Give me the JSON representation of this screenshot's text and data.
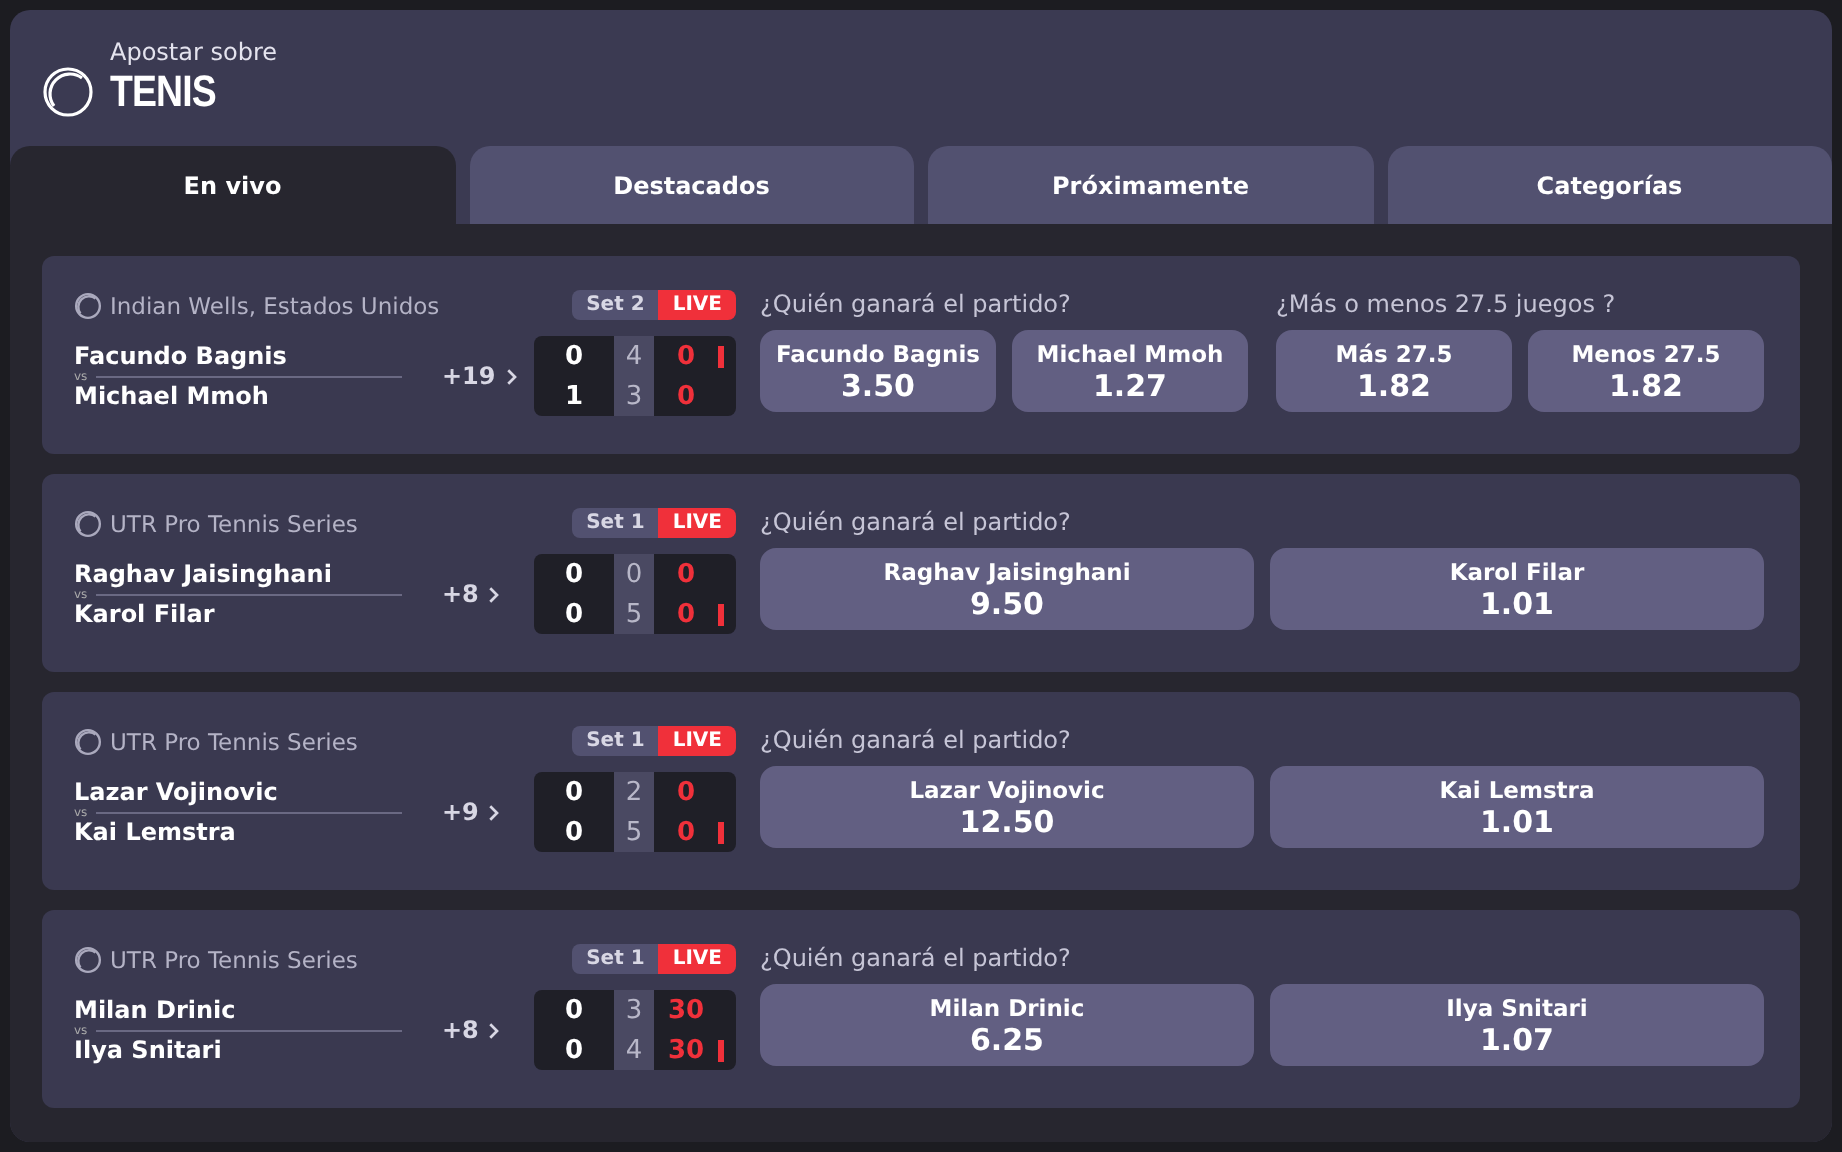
{
  "header": {
    "subtitle": "Apostar sobre",
    "title": "TENIS"
  },
  "tabs": [
    {
      "label": "En vivo",
      "selected": true
    },
    {
      "label": "Destacados",
      "selected": false
    },
    {
      "label": "Próximamente",
      "selected": false
    },
    {
      "label": "Categorías",
      "selected": false
    }
  ],
  "matches": [
    {
      "tournament": "Indian Wells, Estados Unidos",
      "set": "Set 2",
      "live": "LIVE",
      "vs": "vs",
      "more": "+19",
      "players": [
        {
          "name": "Facundo Bagnis",
          "sets": "0",
          "games": "4",
          "points": "0",
          "serving": true
        },
        {
          "name": "Michael Mmoh",
          "sets": "1",
          "games": "3",
          "points": "0",
          "serving": false
        }
      ],
      "markets": [
        {
          "question": "¿Quién ganará el partido?",
          "options": [
            {
              "label": "Facundo Bagnis",
              "odds": "3.50"
            },
            {
              "label": "Michael Mmoh",
              "odds": "1.27"
            }
          ]
        },
        {
          "question": "¿Más o menos 27.5 juegos ?",
          "options": [
            {
              "label": "Más 27.5",
              "odds": "1.82"
            },
            {
              "label": "Menos 27.5",
              "odds": "1.82"
            }
          ]
        }
      ]
    },
    {
      "tournament": "UTR Pro Tennis Series",
      "set": "Set 1",
      "live": "LIVE",
      "vs": "vs",
      "more": "+8",
      "players": [
        {
          "name": "Raghav Jaisinghani",
          "sets": "0",
          "games": "0",
          "points": "0",
          "serving": false
        },
        {
          "name": "Karol Filar",
          "sets": "0",
          "games": "5",
          "points": "0",
          "serving": true
        }
      ],
      "markets": [
        {
          "question": "¿Quién ganará el partido?",
          "options": [
            {
              "label": "Raghav Jaisinghani",
              "odds": "9.50"
            },
            {
              "label": "Karol Filar",
              "odds": "1.01"
            }
          ]
        }
      ]
    },
    {
      "tournament": "UTR Pro Tennis Series",
      "set": "Set 1",
      "live": "LIVE",
      "vs": "vs",
      "more": "+9",
      "players": [
        {
          "name": "Lazar Vojinovic",
          "sets": "0",
          "games": "2",
          "points": "0",
          "serving": false
        },
        {
          "name": "Kai Lemstra",
          "sets": "0",
          "games": "5",
          "points": "0",
          "serving": true
        }
      ],
      "markets": [
        {
          "question": "¿Quién ganará el partido?",
          "options": [
            {
              "label": "Lazar Vojinovic",
              "odds": "12.50"
            },
            {
              "label": "Kai Lemstra",
              "odds": "1.01"
            }
          ]
        }
      ]
    },
    {
      "tournament": "UTR Pro Tennis Series",
      "set": "Set 1",
      "live": "LIVE",
      "vs": "vs",
      "more": "+8",
      "players": [
        {
          "name": "Milan Drinic",
          "sets": "0",
          "games": "3",
          "points": "30",
          "serving": false
        },
        {
          "name": "Ilya Snitari",
          "sets": "0",
          "games": "4",
          "points": "30",
          "serving": true
        }
      ],
      "markets": [
        {
          "question": "¿Quién ganará el partido?",
          "options": [
            {
              "label": "Milan Drinic",
              "odds": "6.25"
            },
            {
              "label": "Ilya Snitari",
              "odds": "1.07"
            }
          ]
        }
      ]
    }
  ]
}
